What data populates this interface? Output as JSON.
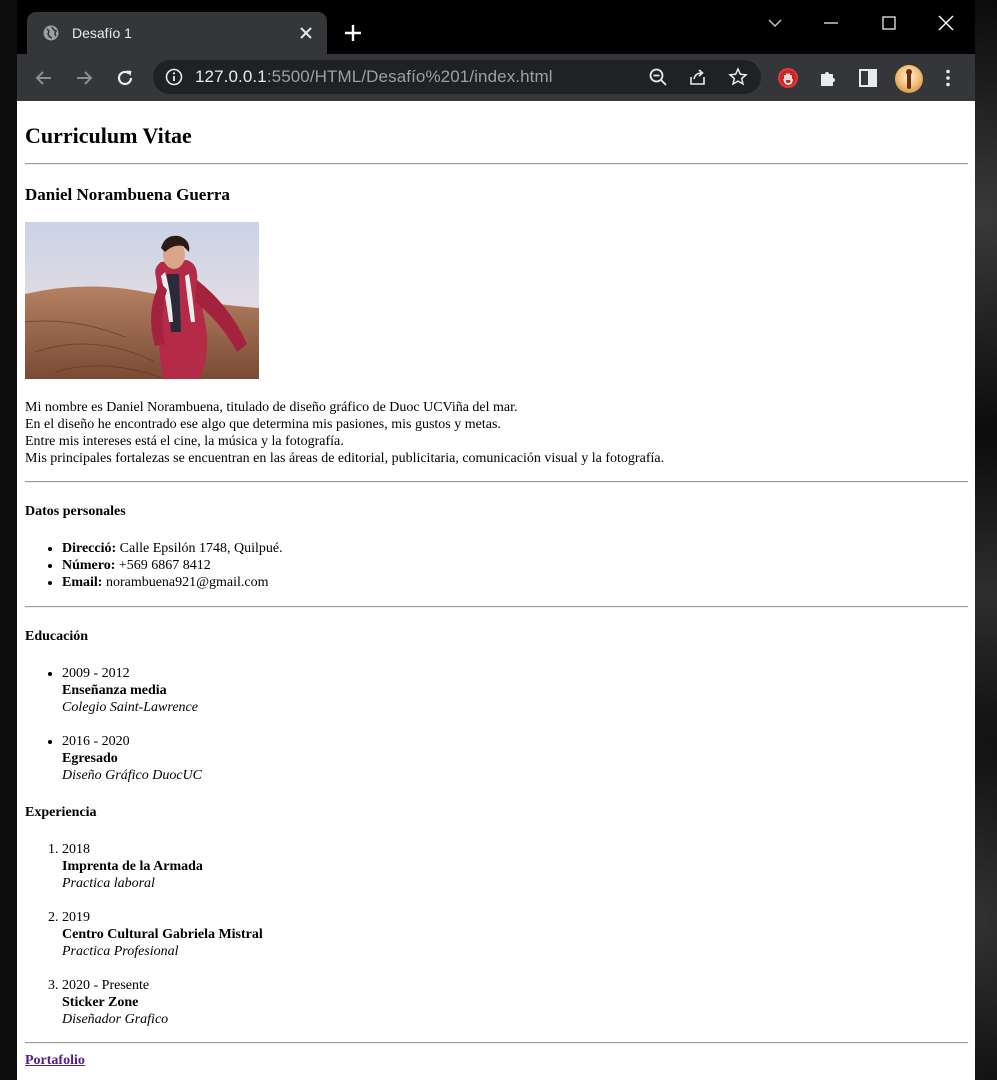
{
  "browser": {
    "tab_title": "Desafío 1",
    "url_host": "127.0.0.1",
    "url_rest": ":5500/HTML/Desafío%201/index.html"
  },
  "page": {
    "title": "Curriculum Vitae",
    "name": "Daniel Norambuena Guerra",
    "bio": [
      "Mi nombre es Daniel Norambuena, titulado de diseño gráfico de Duoc UCViña del mar.",
      "En el diseño he encontrado ese algo que determina mis pasiones, mis gustos y metas.",
      "Entre mis intereses está el cine, la música y la fotografía.",
      "Mis principales fortalezas se encuentran en las áreas de editorial, publicitaria, comunicación visual y la fotografía."
    ],
    "personal": {
      "heading": "Datos personales",
      "items": [
        {
          "label": "Direcció:",
          "value": " Calle Epsilón 1748, Quilpué."
        },
        {
          "label": "Número:",
          "value": " +569 6867 8412"
        },
        {
          "label": "Email:",
          "value": " norambuena921@gmail.com"
        }
      ]
    },
    "education": {
      "heading": "Educación",
      "items": [
        {
          "years": "2009 - 2012",
          "title": "Enseñanza media",
          "place": "Colegio Saint-Lawrence"
        },
        {
          "years": "2016 - 2020",
          "title": "Egresado",
          "place": "Diseño Gráfico DuocUC"
        }
      ]
    },
    "experience": {
      "heading": "Experiencia",
      "items": [
        {
          "years": "2018",
          "title": "Imprenta de la Armada",
          "role": "Practica laboral"
        },
        {
          "years": "2019",
          "title": "Centro Cultural Gabriela Mistral",
          "role": "Practica Profesional"
        },
        {
          "years": "2020 - Presente",
          "title": "Sticker Zone",
          "role": "Diseñador Grafico"
        }
      ]
    },
    "portfolio_link": "Portafolio"
  }
}
